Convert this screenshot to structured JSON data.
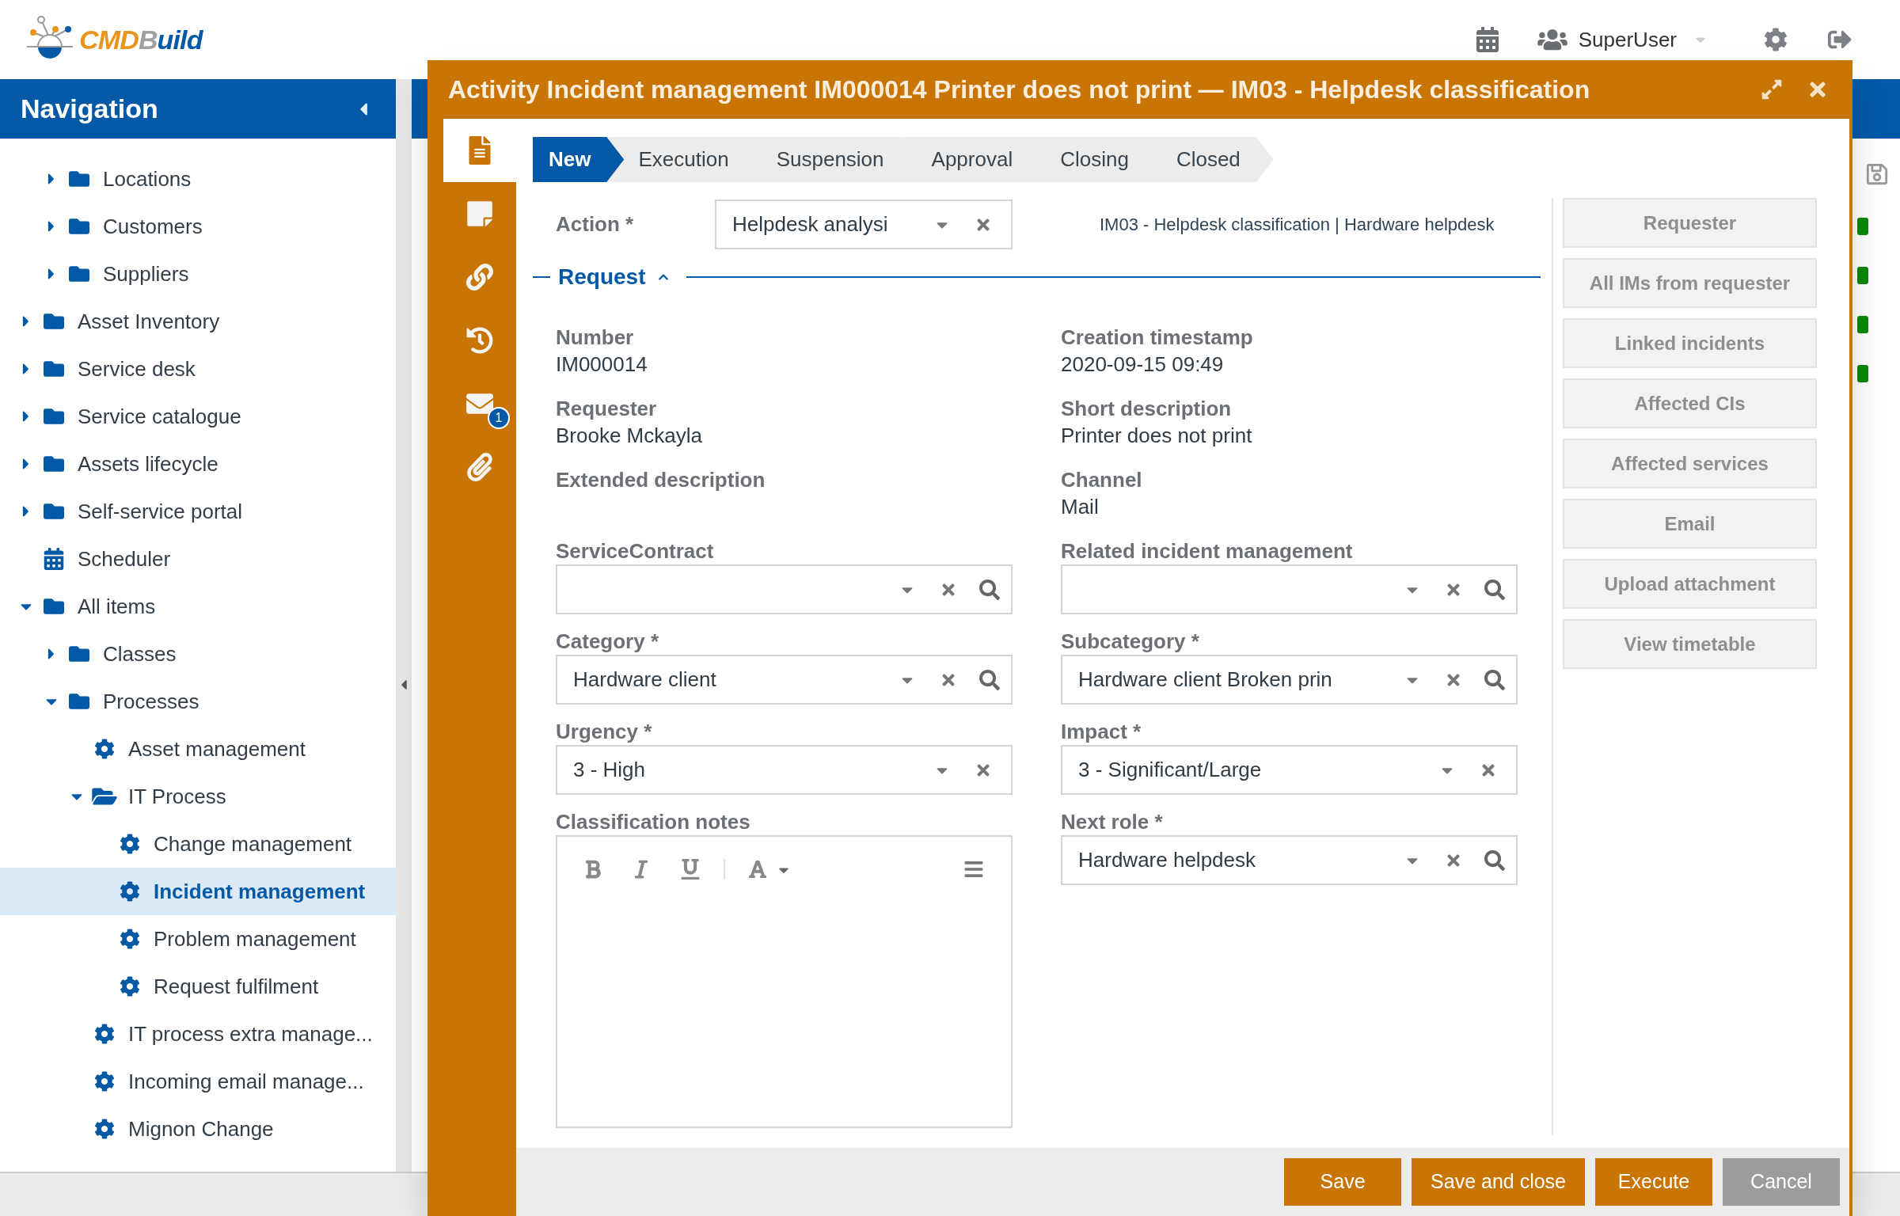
{
  "header": {
    "logo": {
      "part1": "CMD",
      "part2": "B",
      "part3": "uild"
    },
    "user": "SuperUser"
  },
  "navigation": {
    "title": "Navigation",
    "tree": [
      {
        "kind": "group",
        "children": [
          {
            "label": "Locations",
            "kind": "folder",
            "expanded": false,
            "selected": false
          },
          {
            "label": "Customers",
            "kind": "folder",
            "expanded": false,
            "selected": false
          },
          {
            "label": "Suppliers",
            "kind": "folder",
            "expanded": false,
            "selected": false
          }
        ]
      },
      {
        "label": "Asset Inventory",
        "kind": "folder",
        "expanded": false,
        "selected": false
      },
      {
        "label": "Service desk",
        "kind": "folder",
        "expanded": false,
        "selected": false
      },
      {
        "label": "Service catalogue",
        "kind": "folder",
        "expanded": false,
        "selected": false
      },
      {
        "label": "Assets lifecycle",
        "kind": "folder",
        "expanded": false,
        "selected": false
      },
      {
        "label": "Self-service portal",
        "kind": "folder",
        "expanded": false,
        "selected": false
      },
      {
        "label": "Scheduler",
        "kind": "calendar",
        "selected": false
      },
      {
        "label": "All items",
        "kind": "folder",
        "expanded": true,
        "selected": false,
        "children": [
          {
            "label": "Classes",
            "kind": "folder",
            "expanded": false,
            "selected": false
          },
          {
            "label": "Processes",
            "kind": "folder",
            "expanded": true,
            "selected": false,
            "children": [
              {
                "label": "Asset management",
                "kind": "process",
                "selected": false
              },
              {
                "label": "IT Process",
                "kind": "open-folder",
                "expanded": true,
                "selected": false,
                "children": [
                  {
                    "label": "Change management",
                    "kind": "process",
                    "selected": false
                  },
                  {
                    "label": "Incident management",
                    "kind": "process",
                    "selected": true
                  },
                  {
                    "label": "Problem management",
                    "kind": "process",
                    "selected": false
                  },
                  {
                    "label": "Request fulfilment",
                    "kind": "process",
                    "selected": false
                  }
                ]
              },
              {
                "label": "IT process extra manage...",
                "kind": "process",
                "selected": false
              },
              {
                "label": "Incoming email manage...",
                "kind": "process",
                "selected": false
              },
              {
                "label": "Mignon Change",
                "kind": "process",
                "selected": false
              }
            ]
          }
        ]
      }
    ]
  },
  "dialog": {
    "title": "Activity Incident management IM000014 Printer does not print — IM03 - Helpdesk classification",
    "side_tabs": [
      {
        "kind": "form",
        "selected": true
      },
      {
        "kind": "notes",
        "selected": false
      },
      {
        "kind": "relations",
        "selected": false
      },
      {
        "kind": "history",
        "selected": false
      },
      {
        "kind": "email",
        "selected": false,
        "badge": "1"
      },
      {
        "kind": "attachments",
        "selected": false
      }
    ],
    "steps": [
      {
        "label": "New",
        "selected": true
      },
      {
        "label": "Execution",
        "selected": false
      },
      {
        "label": "Suspension",
        "selected": false
      },
      {
        "label": "Approval",
        "selected": false
      },
      {
        "label": "Closing",
        "selected": false
      },
      {
        "label": "Closed",
        "selected": false
      }
    ],
    "action": {
      "label": "Action *",
      "value": "Helpdesk analysi"
    },
    "breadcrumb": "IM03 - Helpdesk classification | Hardware helpdesk",
    "section": {
      "title": "Request",
      "expanded": true
    },
    "fields": [
      {
        "kind": "display",
        "label": "Number",
        "value": "IM000014"
      },
      {
        "kind": "display",
        "label": "Creation timestamp",
        "value": "2020-09-15 09:49"
      },
      {
        "kind": "display",
        "label": "Requester",
        "value": "Brooke Mckayla"
      },
      {
        "kind": "display",
        "label": "Short description",
        "value": "Printer does not print"
      },
      {
        "kind": "display",
        "label": "Extended description"
      },
      {
        "kind": "display",
        "label": "Channel",
        "value": "Mail"
      },
      {
        "kind": "combo",
        "label": "ServiceContract",
        "search": true
      },
      {
        "kind": "combo",
        "label": "Related incident management",
        "search": true
      },
      {
        "kind": "combo",
        "label": "Category *",
        "value": "Hardware client",
        "search": true
      },
      {
        "kind": "combo",
        "label": "Subcategory *",
        "value": "Hardware client Broken prin",
        "search": true
      },
      {
        "kind": "combo",
        "label": "Urgency *",
        "value": "3 - High",
        "search": false
      },
      {
        "kind": "combo",
        "label": "Impact *",
        "value": "3 - Significant/Large",
        "search": false
      },
      {
        "kind": "editor",
        "label": "Classification notes"
      },
      {
        "kind": "combo",
        "label": "Next role *",
        "value": "Hardware helpdesk",
        "search": true
      }
    ],
    "side_buttons": [
      "Requester",
      "All IMs from requester",
      "Linked incidents",
      "Affected CIs",
      "Affected services",
      "Email",
      "Upload attachment",
      "View timetable"
    ],
    "buttons": [
      {
        "label": "Save",
        "kind": "primary"
      },
      {
        "label": "Save and close",
        "kind": "primary"
      },
      {
        "label": "Execute",
        "kind": "primary"
      },
      {
        "label": "Cancel",
        "kind": "secondary"
      }
    ]
  }
}
